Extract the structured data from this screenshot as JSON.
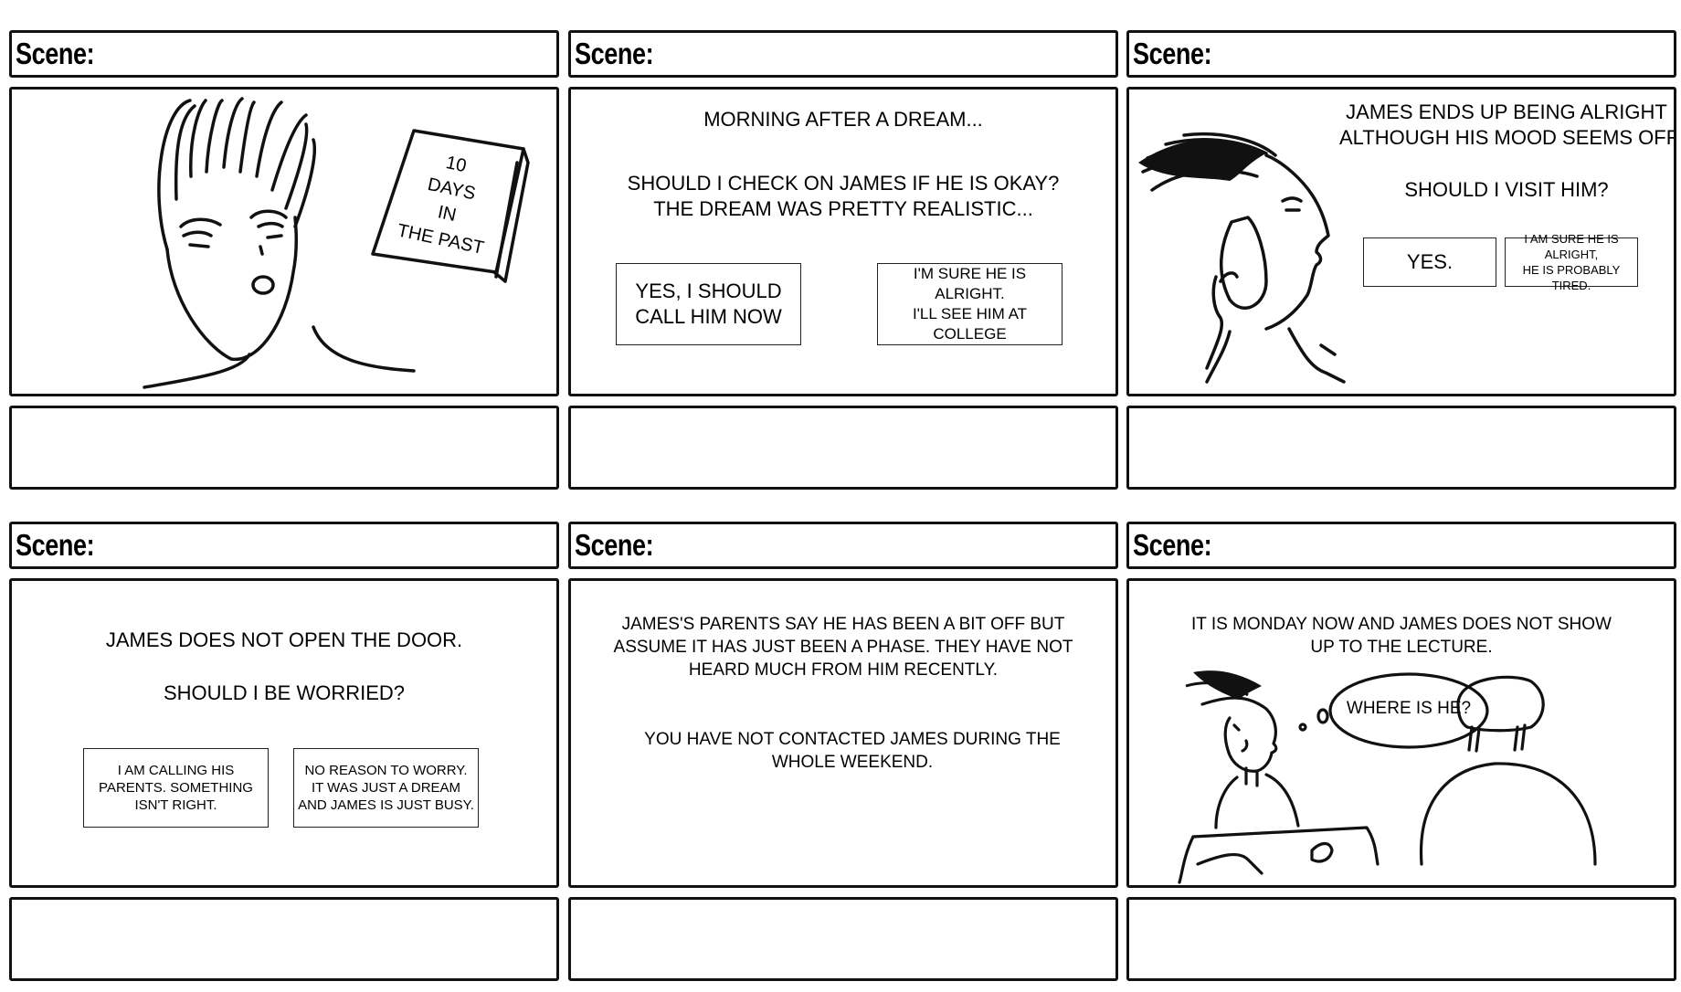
{
  "scene_label": "Scene:",
  "panels": [
    {
      "art_text": [
        "10",
        "DAYS",
        "IN",
        "THE PAST"
      ]
    },
    {
      "title": "MORNING AFTER A DREAM...",
      "body": [
        "SHOULD I CHECK ON JAMES IF HE IS OKAY?",
        "THE DREAM WAS PRETTY REALISTIC..."
      ],
      "choice_a": "YES, I SHOULD\nCALL HIM NOW",
      "choice_b": "I'M SURE HE IS ALRIGHT.\nI'LL SEE HIM AT COLLEGE"
    },
    {
      "body": [
        "JAMES ENDS UP BEING ALRIGHT",
        "ALTHOUGH HIS MOOD SEEMS OFF."
      ],
      "question": "SHOULD I VISIT HIM?",
      "choice_a": "YES.",
      "choice_b": "I AM SURE HE IS\nALRIGHT,\nHE IS PROBABLY TIRED."
    },
    {
      "body": "JAMES DOES NOT OPEN THE DOOR.",
      "question": "SHOULD I BE WORRIED?",
      "choice_a": "I AM CALLING HIS\nPARENTS. SOMETHING\nISN'T RIGHT.",
      "choice_b": "NO REASON TO WORRY.\nIT WAS JUST A DREAM\nAND JAMES IS JUST BUSY."
    },
    {
      "body": [
        "JAMES'S PARENTS SAY HE HAS BEEN A BIT OFF BUT",
        "ASSUME IT HAS JUST BEEN A PHASE. THEY HAVE NOT",
        "HEARD MUCH FROM HIM RECENTLY."
      ],
      "body2": [
        "YOU HAVE NOT CONTACTED JAMES DURING THE",
        "WHOLE WEEKEND."
      ]
    },
    {
      "body": [
        "IT IS MONDAY NOW AND JAMES DOES NOT SHOW",
        "UP TO THE LECTURE."
      ],
      "bubble": "WHERE IS HE?"
    }
  ]
}
